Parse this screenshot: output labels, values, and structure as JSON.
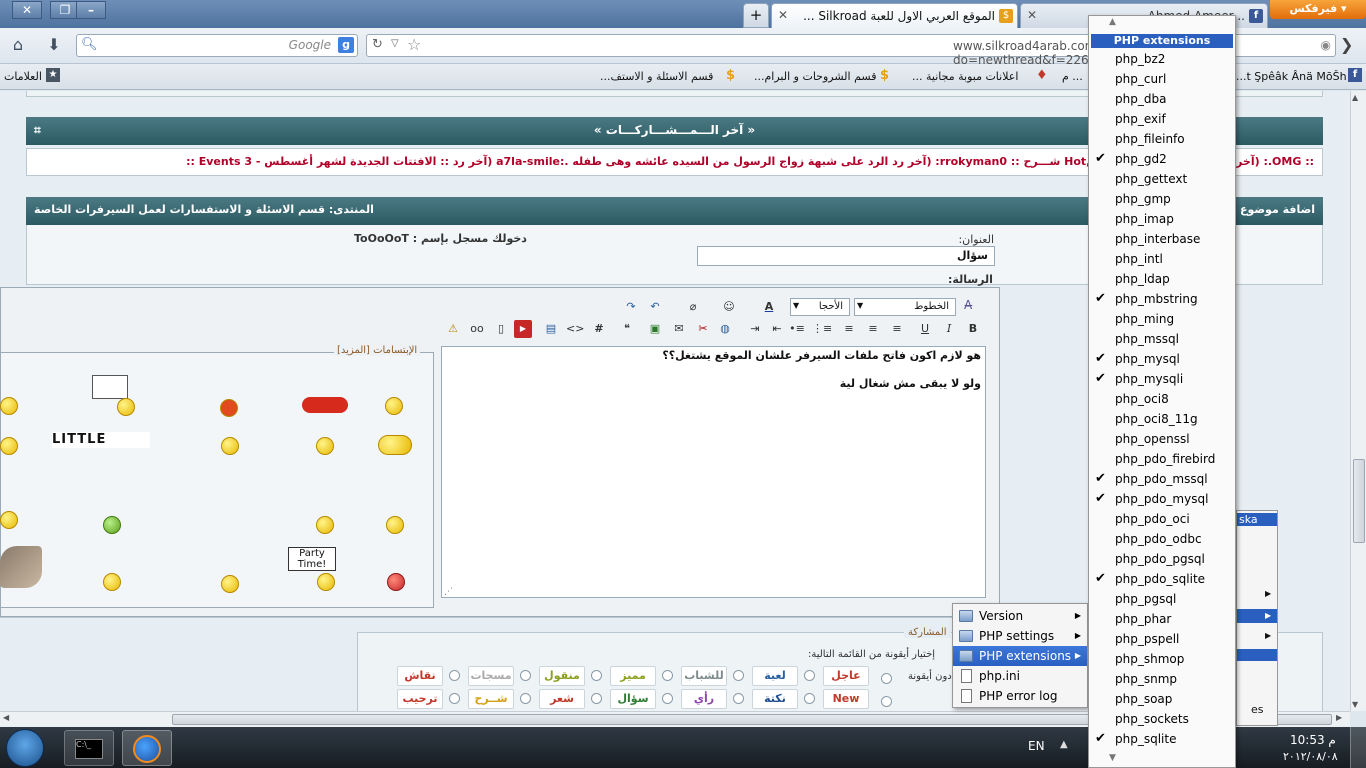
{
  "browser": {
    "firefox_button": "فيرفكس",
    "tabs": [
      {
        "title": "الموقع العربي الاول للعبة Silkroad ..."
      },
      {
        "title": "...Ahmed Ameer"
      }
    ]
  },
  "nav": {
    "search_placeholder": "Google",
    "url": "www.silkroad4arab.com/vb/newthread.php?do=newthread&f=226"
  },
  "bookmarks": {
    "label": "العلامات",
    "items": [
      "قسم الاسئلة و الاستف...",
      "قسم الشروحات و البرام...",
      "اعلانات مبوبة مجانية ...",
      "... م",
      "t Şpêâk Ânä MōŠh..."
    ]
  },
  "forum": {
    "latest_banner": "« آخر الـــمـــشـــاركـــات »",
    "ticker": ":: OMG.: (آخر رد Hot,Hot Summer Update شـــرح :: rrokyman0: (آخر رد الرد على شبهة زواج الرسول من السيده عائشه وهى طفله .:a7la-smile (آخر رد :: الافتتات الجديدة لشهر أغسطس - 3 Events ::",
    "new_thread": "اضافة موضوع",
    "breadcrumb": "المنتدى: قسم الاسئلة و الاستفسارات لعمل السيرفرات الخاصة",
    "title_label": "العنوان:",
    "title_value": "سؤال",
    "logged_in": "دخولك مسجل بإسم : ToOoOoT",
    "message_label": "الرسالة:",
    "font_select": "الخطوط",
    "size_select": "الأحجا",
    "message_lines": [
      "هو لازم اكون فاتح ملفات السيرفر علشان الموقع يشتغل؟؟",
      "ولو لا يبقى مش شغال لية"
    ],
    "smilies_title": "الإبتسامات [المزيد]",
    "party_sign": "Party Time!",
    "little_text": "LITTLE",
    "participation": "المشاركة",
    "icon_hint": "إختيار أيقونة من القائمة التالية:",
    "icon_label": "دون أيقونة",
    "tags_row1": [
      "عاجل",
      "لعبة",
      "للشباب",
      "مميز",
      "منقول",
      "مسجات",
      "نقاش"
    ],
    "tags_row2": [
      "New",
      "نكتة",
      "رأي",
      "سؤال",
      "شعر",
      "شــرح",
      "ترحيب"
    ],
    "tag_colors_row1": [
      "#c0392b",
      "#2a5f9e",
      "#7f8c8d",
      "#8aa01e",
      "#8aa01e",
      "#aaaaaa",
      "#c0392b"
    ],
    "tag_colors_row2": [
      "#c0392b",
      "#1f4f8a",
      "#8e44ad",
      "#2e7d32",
      "#c0392b",
      "#d4a017",
      "#c0392b"
    ]
  },
  "taskbar": {
    "lang": "EN",
    "time": "10:53 م",
    "date": "٢٠١٢/٠٨/٠٨"
  },
  "menu": {
    "main_items": [
      "Version",
      "PHP settings",
      "PHP extensions",
      "php.ini",
      "PHP error log"
    ],
    "highlighted": "PHP extensions",
    "submenu_title": "PHP extensions",
    "extensions": [
      {
        "name": "php_bz2",
        "checked": false
      },
      {
        "name": "php_curl",
        "checked": false
      },
      {
        "name": "php_dba",
        "checked": false
      },
      {
        "name": "php_exif",
        "checked": false
      },
      {
        "name": "php_fileinfo",
        "checked": false
      },
      {
        "name": "php_gd2",
        "checked": true
      },
      {
        "name": "php_gettext",
        "checked": false
      },
      {
        "name": "php_gmp",
        "checked": false
      },
      {
        "name": "php_imap",
        "checked": false
      },
      {
        "name": "php_interbase",
        "checked": false
      },
      {
        "name": "php_intl",
        "checked": false
      },
      {
        "name": "php_ldap",
        "checked": false
      },
      {
        "name": "php_mbstring",
        "checked": true
      },
      {
        "name": "php_ming",
        "checked": false
      },
      {
        "name": "php_mssql",
        "checked": false
      },
      {
        "name": "php_mysql",
        "checked": true
      },
      {
        "name": "php_mysqli",
        "checked": true
      },
      {
        "name": "php_oci8",
        "checked": false
      },
      {
        "name": "php_oci8_11g",
        "checked": false
      },
      {
        "name": "php_openssl",
        "checked": false
      },
      {
        "name": "php_pdo_firebird",
        "checked": false
      },
      {
        "name": "php_pdo_mssql",
        "checked": true
      },
      {
        "name": "php_pdo_mysql",
        "checked": true
      },
      {
        "name": "php_pdo_oci",
        "checked": false
      },
      {
        "name": "php_pdo_odbc",
        "checked": false
      },
      {
        "name": "php_pdo_pgsql",
        "checked": false
      },
      {
        "name": "php_pdo_sqlite",
        "checked": true
      },
      {
        "name": "php_pgsql",
        "checked": false
      },
      {
        "name": "php_phar",
        "checked": false
      },
      {
        "name": "php_pspell",
        "checked": false
      },
      {
        "name": "php_shmop",
        "checked": false
      },
      {
        "name": "php_snmp",
        "checked": false
      },
      {
        "name": "php_soap",
        "checked": false
      },
      {
        "name": "php_sockets",
        "checked": false
      },
      {
        "name": "php_sqlite",
        "checked": true
      }
    ],
    "wamp_fragment_1": "ska",
    "wamp_fragment_2": "es"
  }
}
